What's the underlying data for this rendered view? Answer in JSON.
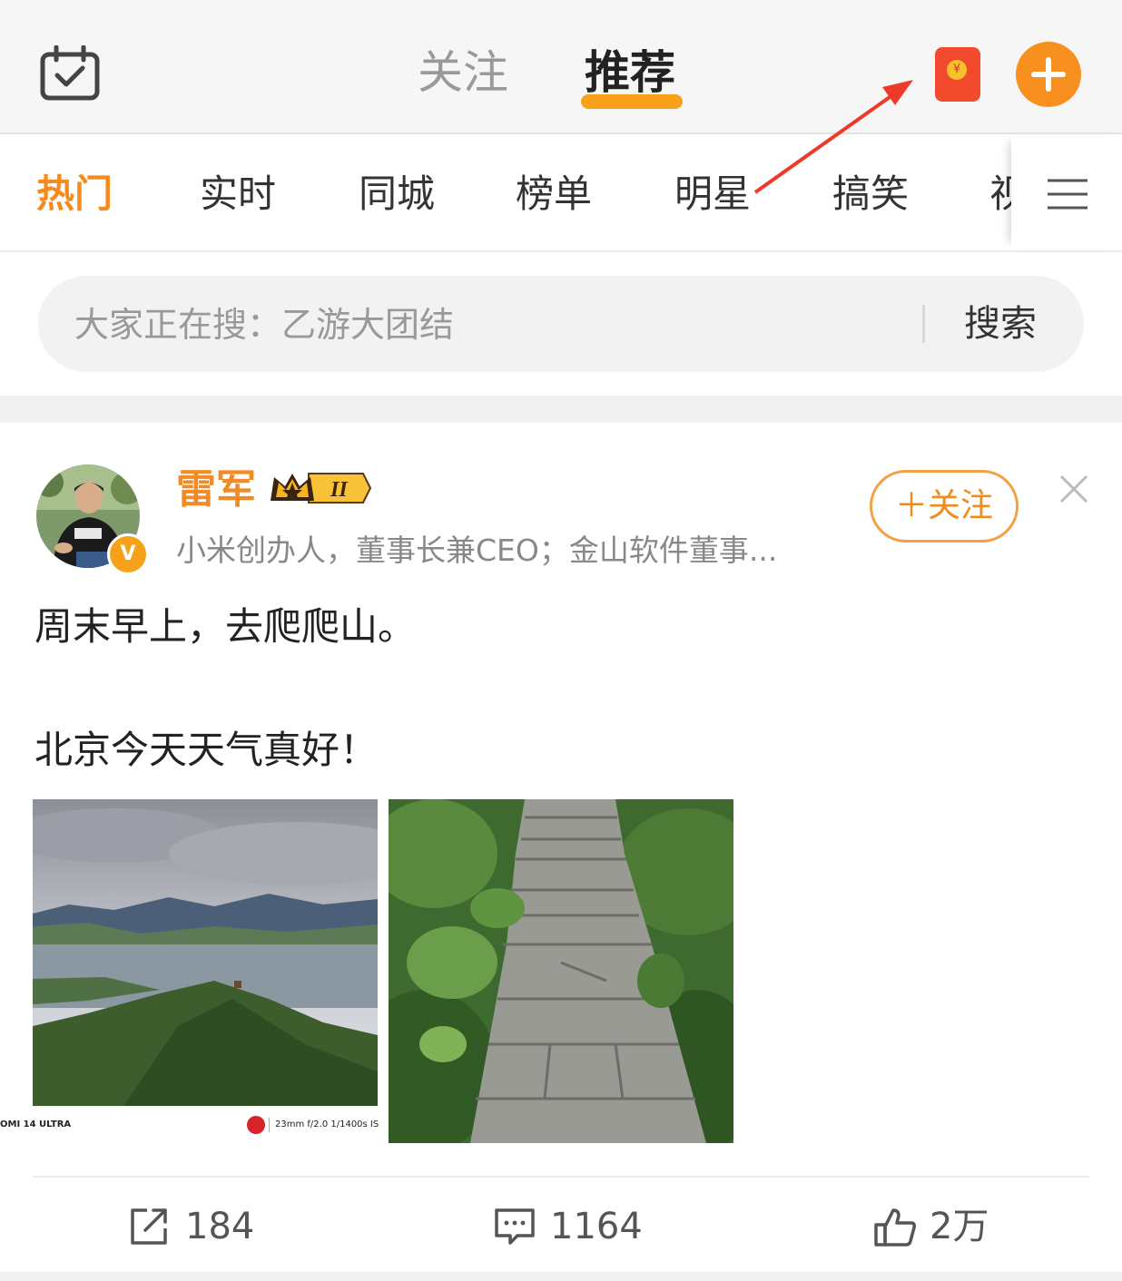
{
  "header": {
    "tabs": [
      {
        "label": "关注",
        "active": false
      },
      {
        "label": "推荐",
        "active": true
      }
    ],
    "icons": {
      "checkin": "calendar-check-icon",
      "red_packet": "red-packet-icon",
      "red_packet_symbol": "¥",
      "add": "plus-icon"
    },
    "accent_color": "#f7a01a"
  },
  "channels": {
    "items": [
      "热门",
      "实时",
      "同城",
      "榜单",
      "明星",
      "搞笑",
      "视"
    ],
    "active_index": 0,
    "active_color": "#f58a1f",
    "menu_icon": "menu-icon"
  },
  "search": {
    "placeholder": "大家正在搜：乙游大团结",
    "button_label": "搜索"
  },
  "post": {
    "author": {
      "name": "雷军",
      "bio": "小米创办人，董事长兼CEO；金山软件董事...",
      "verified_badge": "V",
      "crown_level": "II",
      "name_color": "#f28a25"
    },
    "follow_label": "＋关注",
    "text_lines": [
      "周末早上，去爬爬山。",
      "北京今天天气真好！"
    ],
    "photos": [
      {
        "watermark_model": "OMI 14 ULTRA",
        "watermark_exif": "23mm  f/2.0  1/1400s  IS"
      },
      {}
    ],
    "actions": {
      "repost": {
        "icon": "share-icon",
        "count": "184"
      },
      "comment": {
        "icon": "comment-icon",
        "count": "1164"
      },
      "like": {
        "icon": "thumbs-up-icon",
        "count": "2万"
      }
    }
  }
}
